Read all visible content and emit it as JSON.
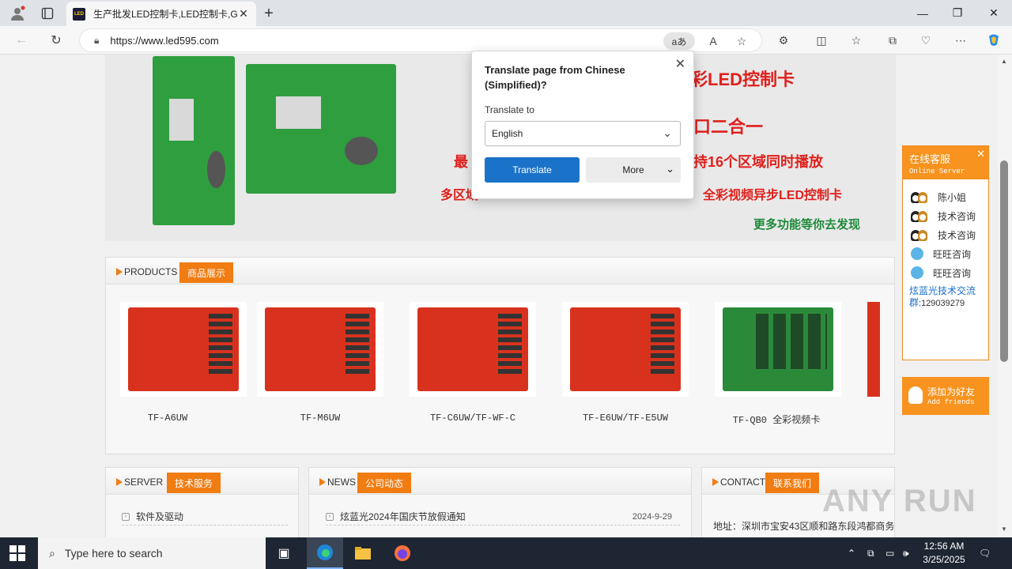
{
  "browser": {
    "tab_title": "生产批发LED控制卡,LED控制卡,G",
    "url": "https://www.led595.com",
    "reader_badge": "aあ"
  },
  "banner": {
    "line1": "彩LED控制卡",
    "line2": "口二合一",
    "line3_left": "最",
    "line3_right": "持16个区域同时播放",
    "line4_left": "多区域",
    "line4_right": "全彩视频异步LED控制卡",
    "more": "更多功能等你去发现"
  },
  "products": {
    "en": "PRODUCTS",
    "cn": "商品展示",
    "items": [
      {
        "label": "TF-A6UW"
      },
      {
        "label": "TF-M6UW"
      },
      {
        "label": "TF-C6UW/TF-WF-C"
      },
      {
        "label": "TF-E6UW/TF-E5UW"
      },
      {
        "label": "TF-QB0 全彩视频卡"
      }
    ]
  },
  "server": {
    "en": "SERVER",
    "cn": "技术服务",
    "row1": "软件及驱动"
  },
  "news": {
    "en": "NEWS",
    "cn": "公司动态",
    "row1": "炫蓝光2024年国庆节放假通知",
    "row1_date": "2024-9-29"
  },
  "contact": {
    "en": "CONTACT",
    "cn": "联系我们",
    "row1": "地址：深圳市宝安43区顺和路东段鸿都商务"
  },
  "chat": {
    "title": "在线客服",
    "subtitle": "Online Server",
    "items": [
      {
        "label": "陈小姐"
      },
      {
        "label": "技术咨询"
      },
      {
        "label": "技术咨询"
      },
      {
        "label": "旺旺咨询"
      },
      {
        "label": "旺旺咨询"
      }
    ],
    "group_text": "炫蓝光技术交流群",
    "group_number": ":129039279",
    "add_friends": "添加为好友",
    "add_friends_en": "Add friends"
  },
  "translate": {
    "title": "Translate page from Chinese (Simplified)?",
    "label": "Translate to",
    "language": "English",
    "translate_btn": "Translate",
    "more_btn": "More"
  },
  "taskbar": {
    "search_placeholder": "Type here to search",
    "time": "12:56 AM",
    "date": "3/25/2025"
  },
  "watermark": "ANY RUN"
}
